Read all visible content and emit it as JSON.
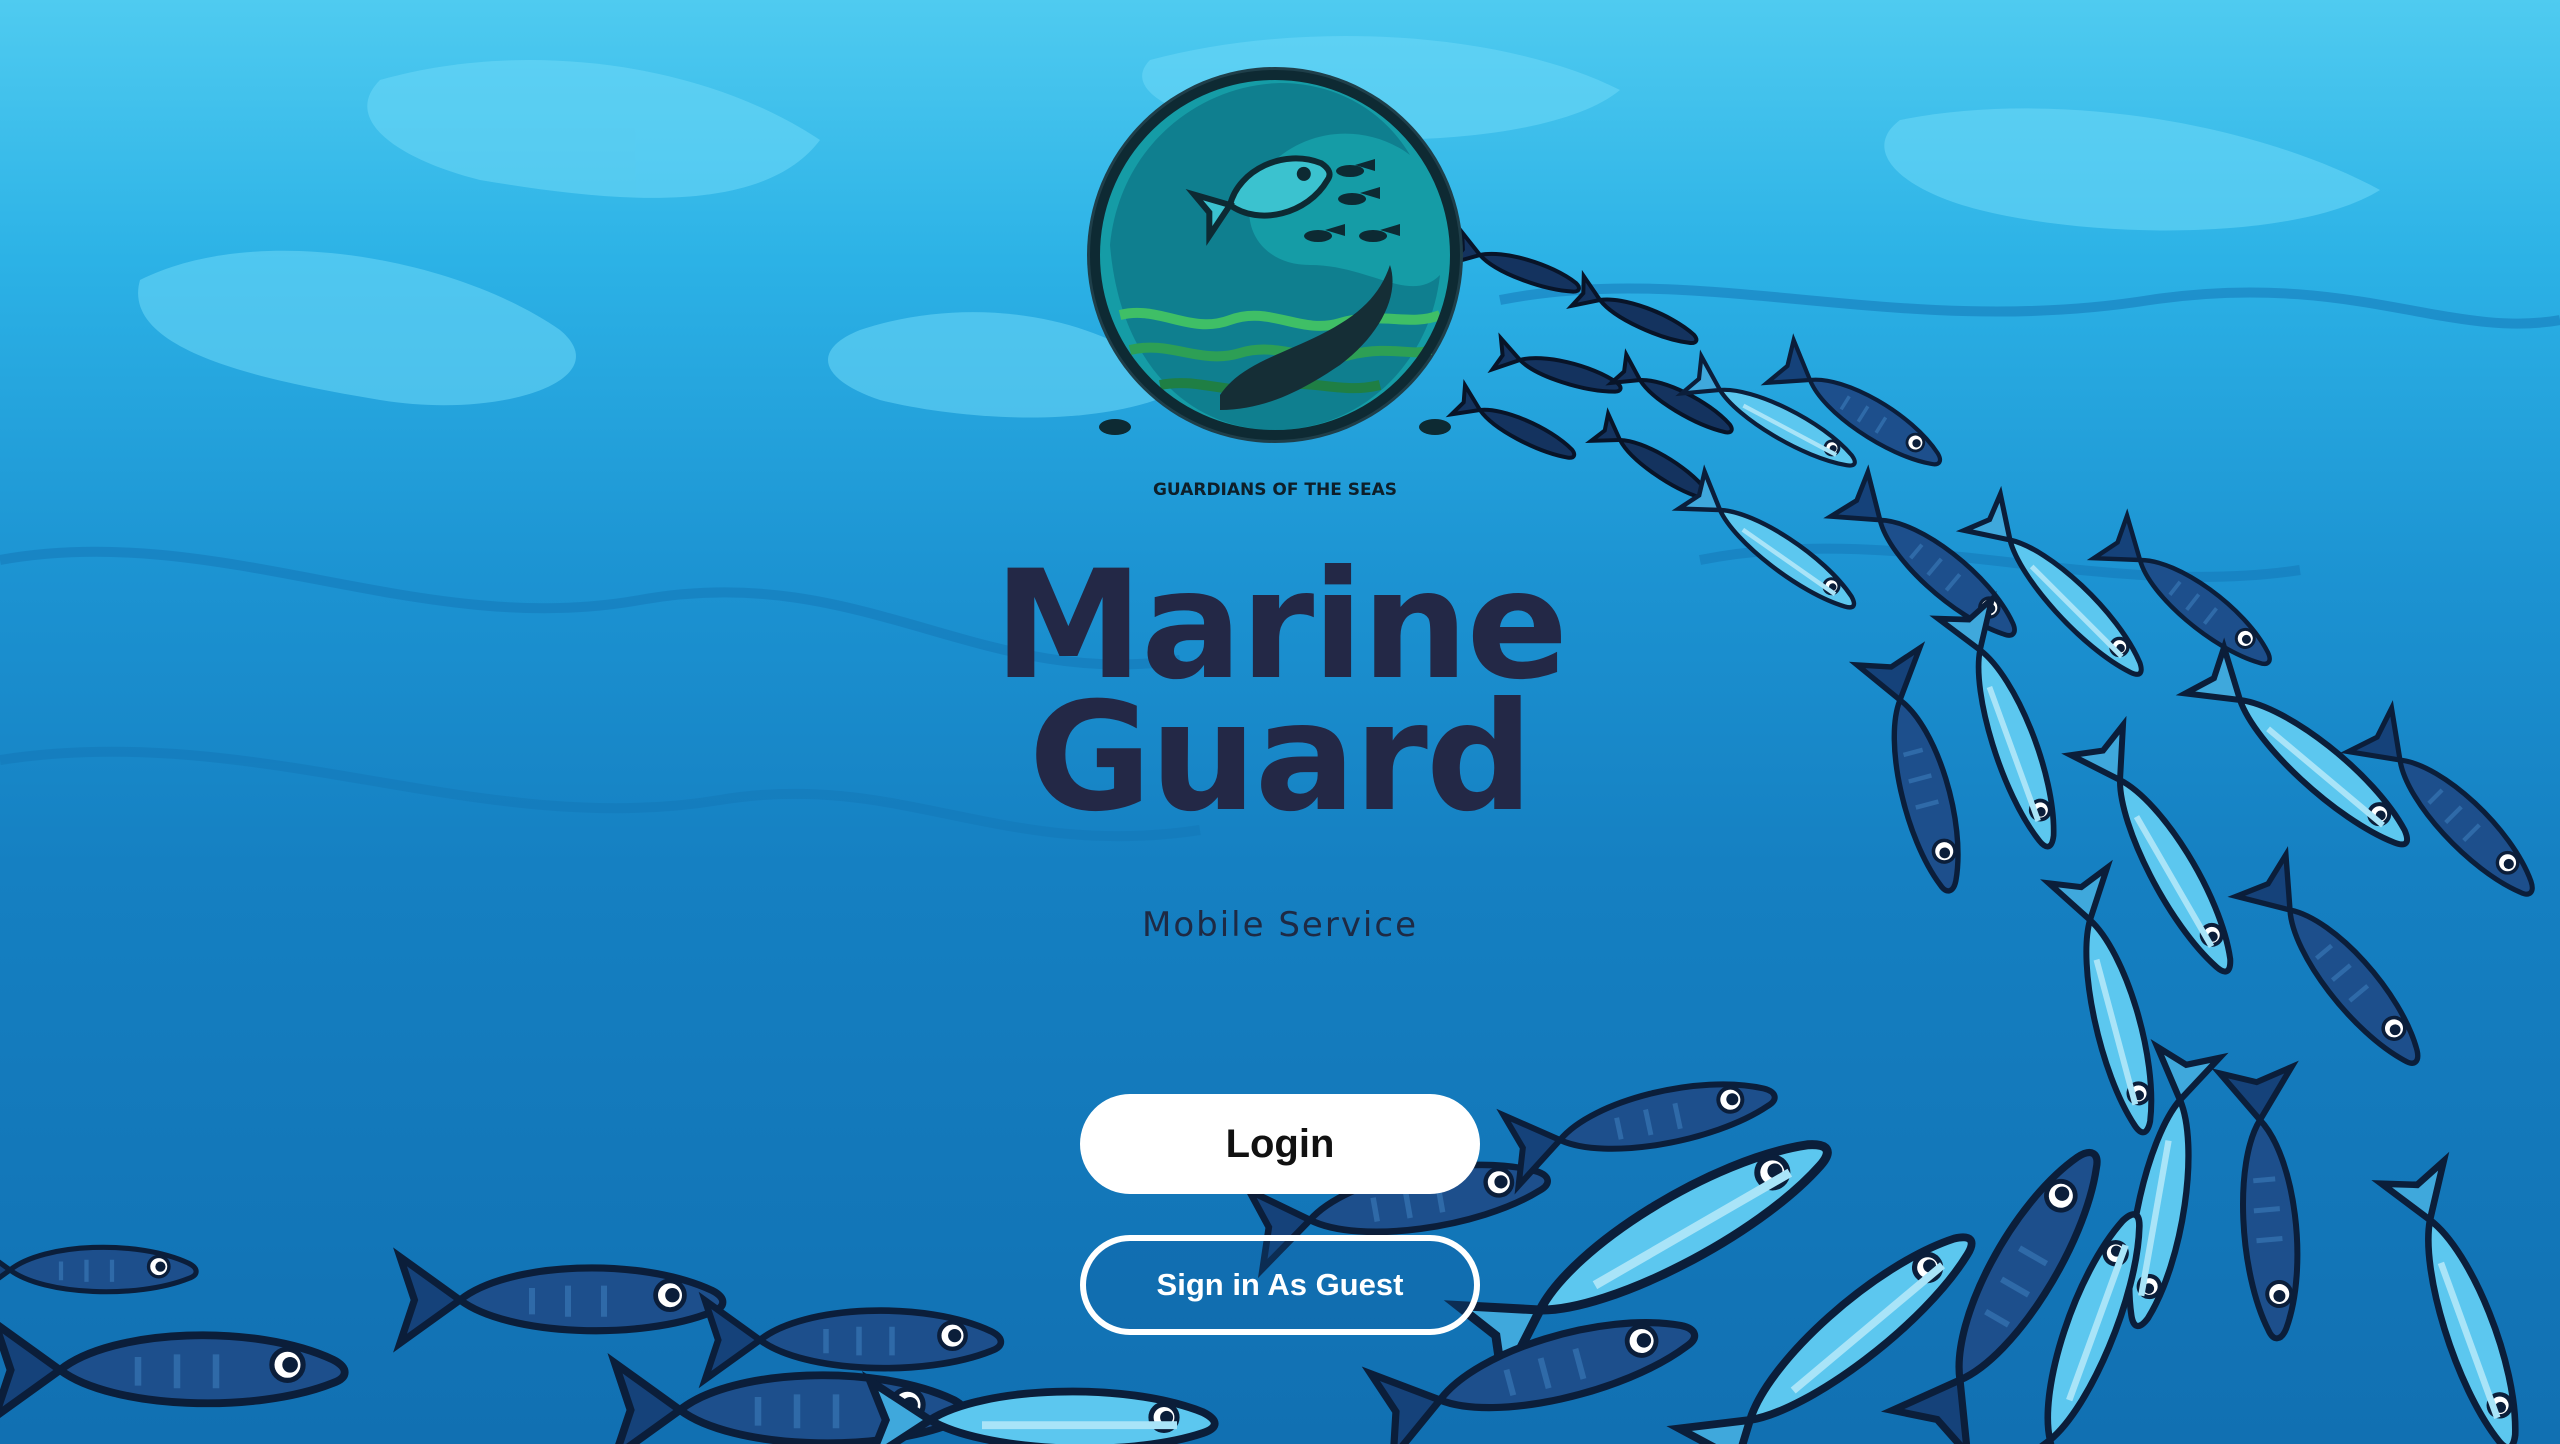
{
  "app": {
    "title_line1": "Marine",
    "title_line2": "Guard",
    "subtitle": "Mobile Service"
  },
  "logo": {
    "icon": "guardians-of-the-seas-logo",
    "caption": "GUARDIANS OF THE SEAS"
  },
  "actions": {
    "login_label": "Login",
    "guest_label": "Sign in As Guest"
  },
  "colors": {
    "title": "#232846",
    "ocean_light": "#4fcbf0",
    "ocean_dark": "#1170b2",
    "button_bg": "#ffffff"
  }
}
